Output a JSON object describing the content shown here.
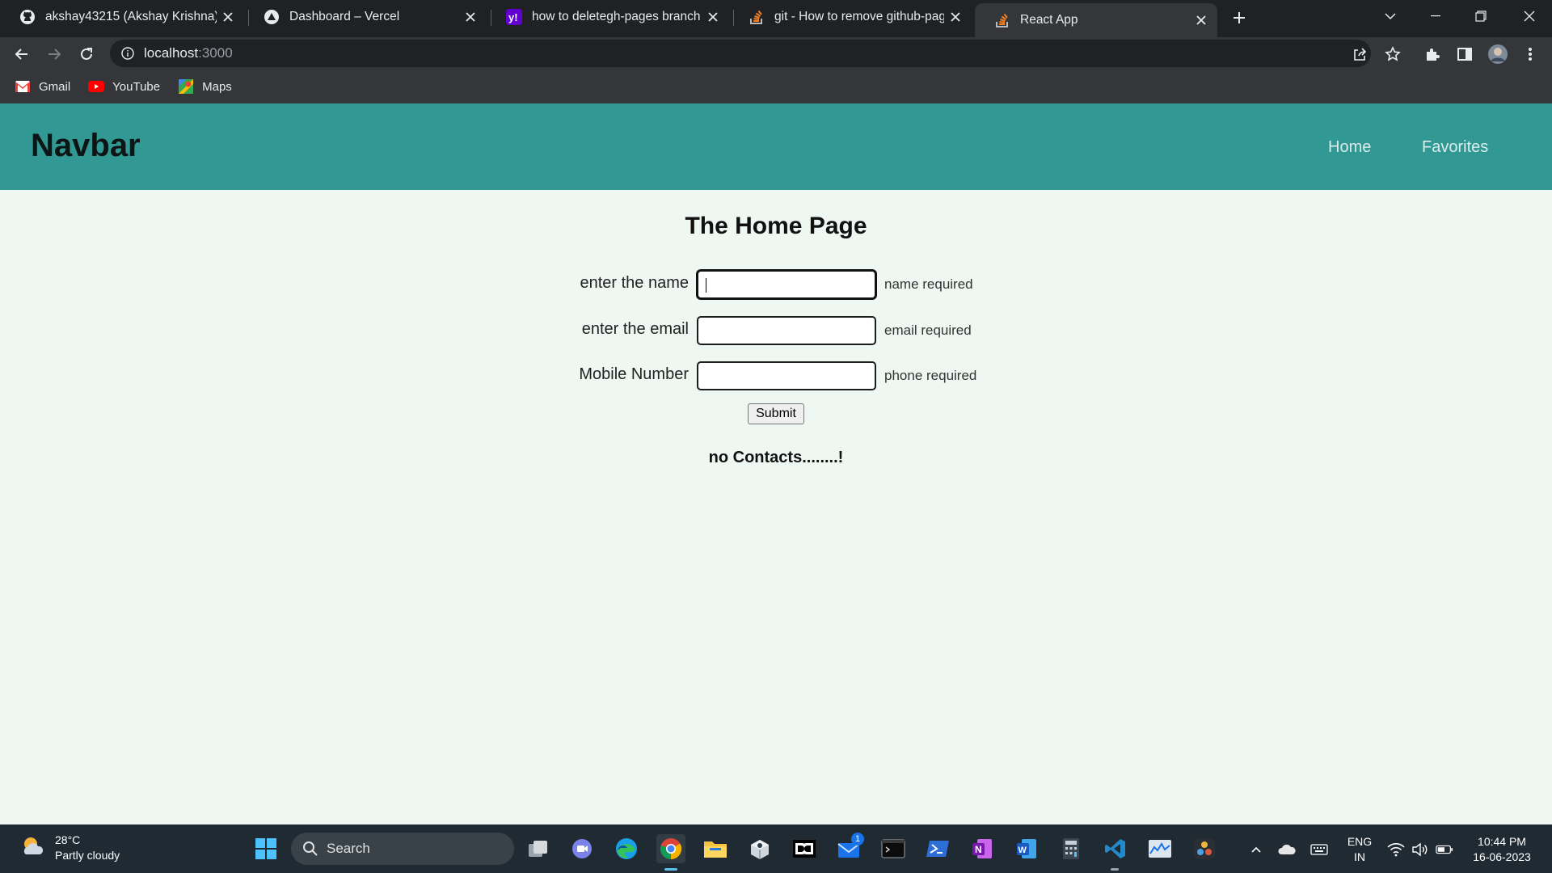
{
  "browser": {
    "tabs": [
      {
        "title": "akshay43215 (Akshay Krishna)",
        "icon": "github-icon"
      },
      {
        "title": "Dashboard – Vercel",
        "icon": "vercel-icon"
      },
      {
        "title": "how to deletegh-pages branch in",
        "icon": "yahoo-icon"
      },
      {
        "title": "git - How to remove github-page",
        "icon": "stackoverflow-icon"
      },
      {
        "title": "React App",
        "icon": "stackoverflow-icon",
        "active": true
      }
    ],
    "url_host": "localhost",
    "url_port": ":3000",
    "bookmarks": [
      {
        "label": "Gmail",
        "icon": "gmail-icon"
      },
      {
        "label": "YouTube",
        "icon": "youtube-icon"
      },
      {
        "label": "Maps",
        "icon": "maps-icon"
      }
    ]
  },
  "app": {
    "navbar": {
      "brand": "Navbar",
      "links": [
        "Home",
        "Favorites"
      ],
      "color": "#329894"
    },
    "title": "The Home Page",
    "form": {
      "fields": [
        {
          "label": "enter the name",
          "value": "",
          "hint": "name required",
          "focused": true
        },
        {
          "label": "enter the email",
          "value": "",
          "hint": "email required"
        },
        {
          "label": "Mobile Number",
          "value": "",
          "hint": "phone required"
        }
      ],
      "submit_label": "Submit"
    },
    "empty_message": "no Contacts........!",
    "background": "#eef7f1"
  },
  "taskbar": {
    "weather": {
      "temp": "28°C",
      "condition": "Partly cloudy"
    },
    "search_label": "Search",
    "mail_badge": "1",
    "language": {
      "line1": "ENG",
      "line2": "IN"
    },
    "time": "10:44 PM",
    "date": "16-06-2023"
  }
}
